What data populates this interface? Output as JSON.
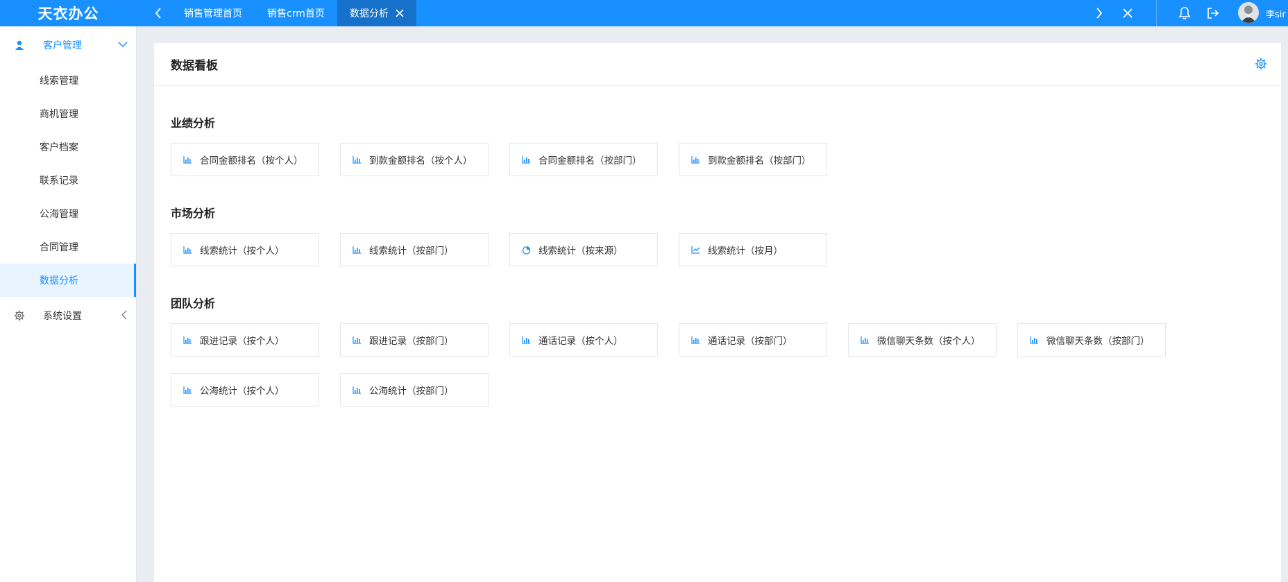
{
  "app": {
    "brand": "天衣办公"
  },
  "tabs": [
    {
      "label": "销售管理首页",
      "active": false
    },
    {
      "label": "销售crm首页",
      "active": false
    },
    {
      "label": "数据分析",
      "active": true
    }
  ],
  "header": {
    "username": "李sir"
  },
  "sidebar": {
    "groups": [
      {
        "label": "客户管理",
        "icon": "user-icon",
        "open": true,
        "items": [
          {
            "label": "线索管理"
          },
          {
            "label": "商机管理"
          },
          {
            "label": "客户档案"
          },
          {
            "label": "联系记录"
          },
          {
            "label": "公海管理"
          },
          {
            "label": "合同管理"
          },
          {
            "label": "数据分析",
            "active": true
          }
        ]
      },
      {
        "label": "系统设置",
        "icon": "gear-icon",
        "open": false
      }
    ]
  },
  "main": {
    "title": "数据看板",
    "sections": [
      {
        "title": "业绩分析",
        "cards": [
          {
            "label": "合同金额排名（按个人）",
            "icon": "bar-chart-icon"
          },
          {
            "label": "到款金额排名（按个人）",
            "icon": "bar-chart-icon"
          },
          {
            "label": "合同金额排名（按部门）",
            "icon": "bar-chart-icon"
          },
          {
            "label": "到款金额排名（按部门）",
            "icon": "bar-chart-icon"
          }
        ]
      },
      {
        "title": "市场分析",
        "cards": [
          {
            "label": "线索统计（按个人）",
            "icon": "bar-chart-icon"
          },
          {
            "label": "线索统计（按部门）",
            "icon": "bar-chart-icon"
          },
          {
            "label": "线索统计（按来源）",
            "icon": "pie-chart-icon"
          },
          {
            "label": "线索统计（按月）",
            "icon": "line-chart-icon"
          }
        ]
      },
      {
        "title": "团队分析",
        "cards": [
          {
            "label": "跟进记录（按个人）",
            "icon": "bar-chart-icon"
          },
          {
            "label": "跟进记录（按部门）",
            "icon": "bar-chart-icon"
          },
          {
            "label": "通话记录（按个人）",
            "icon": "bar-chart-icon"
          },
          {
            "label": "通话记录（按部门）",
            "icon": "bar-chart-icon"
          },
          {
            "label": "微信聊天条数（按个人）",
            "icon": "bar-chart-icon"
          },
          {
            "label": "微信聊天条数（按部门）",
            "icon": "bar-chart-icon"
          },
          {
            "label": "公海统计（按个人）",
            "icon": "bar-chart-icon"
          },
          {
            "label": "公海统计（按部门）",
            "icon": "bar-chart-icon"
          }
        ]
      }
    ]
  },
  "colors": {
    "primary": "#1890ff",
    "active_tab": "#1571c9",
    "sidebar_active_bg": "#e8f4ff"
  }
}
